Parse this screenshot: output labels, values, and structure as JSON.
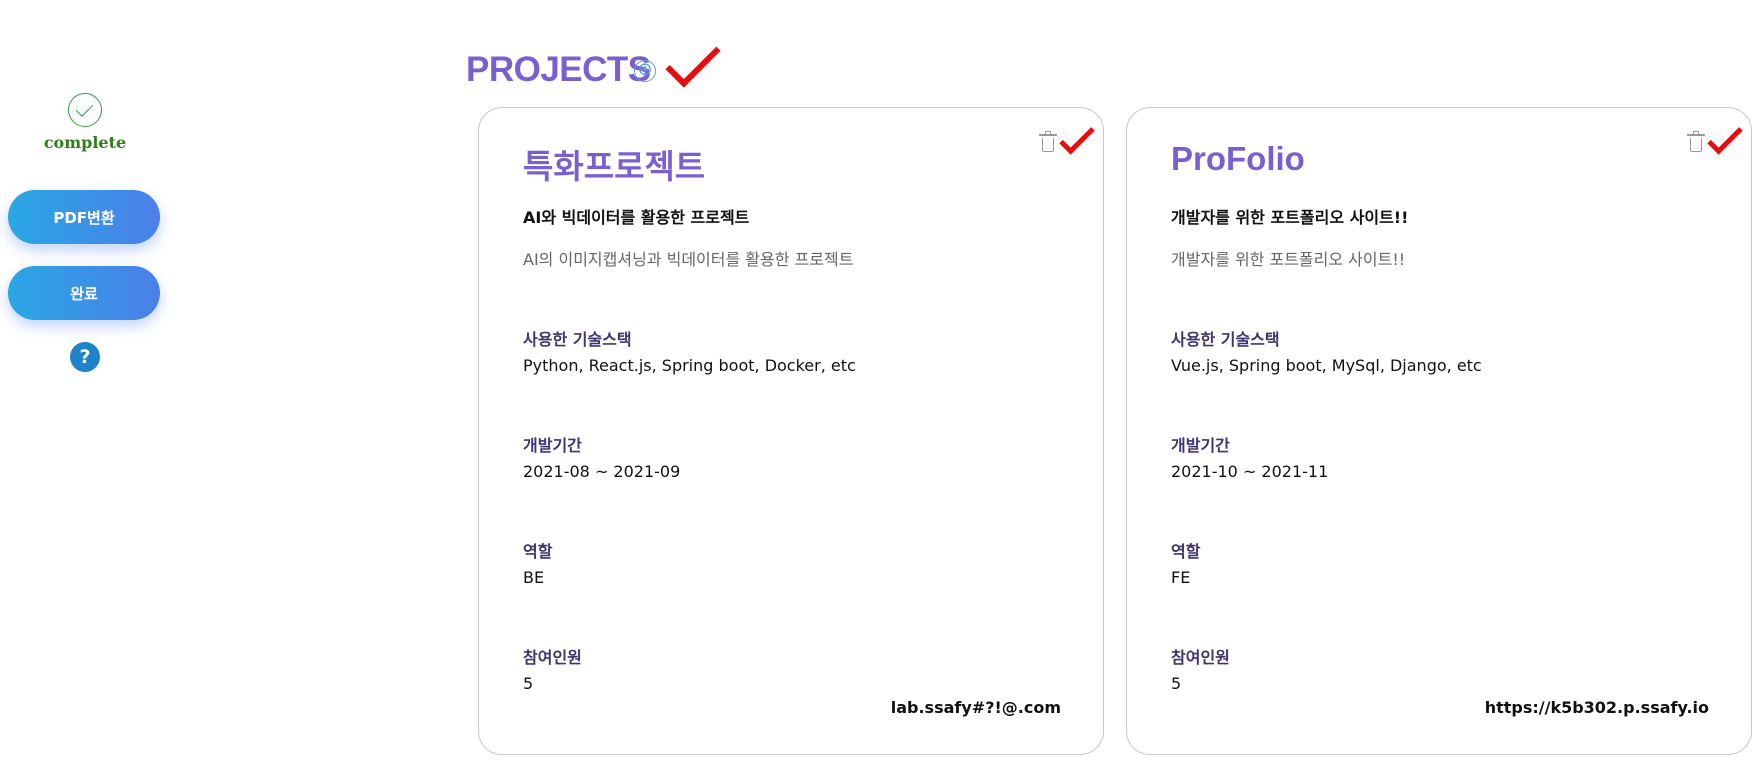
{
  "sidebar": {
    "status_icon": "check-circle-icon",
    "status_label": "complete",
    "pdf_button": "PDF변환",
    "complete_button": "완료",
    "help_icon": "?"
  },
  "header": {
    "title": "PROJECTS",
    "add_icon": "⊕"
  },
  "projects": [
    {
      "title": "특화프로젝트",
      "subtitle": "AI와 빅데이터를 활용한 프로젝트",
      "description": "AI의 이미지캡셔닝과 빅데이터를 활용한 프로젝트",
      "stack_label": "사용한 기술스택",
      "stack": "Python, React.js, Spring boot, Docker, etc",
      "period_label": "개발기간",
      "period": "2021-08 ~ 2021-09",
      "role_label": "역할",
      "role": "BE",
      "members_label": "참여인원",
      "members": "5",
      "link": "lab.ssafy#?!@.com"
    },
    {
      "title": "ProFolio",
      "subtitle": "개발자를 위한 포트폴리오 사이트!!",
      "description": "개발자를 위한 포트폴리오 사이트!!",
      "stack_label": "사용한 기술스택",
      "stack": "Vue.js, Spring boot, MySql, Django, etc",
      "period_label": "개발기간",
      "period": "2021-10 ~ 2021-11",
      "role_label": "역할",
      "role": "FE",
      "members_label": "참여인원",
      "members": "5",
      "link": "https://k5b302.p.ssafy.io"
    }
  ],
  "colors": {
    "accent": "#7b5fd0",
    "check_red": "#e50e0e",
    "complete_green": "#2e9a46",
    "button_gradient_start": "#2aa7e6",
    "button_gradient_end": "#4b7fe8"
  }
}
